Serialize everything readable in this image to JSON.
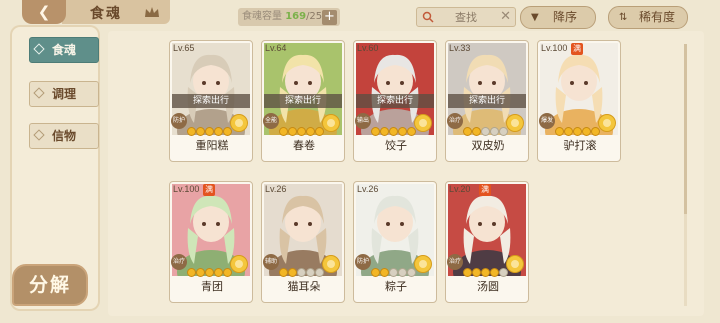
{
  "header": {
    "back_icon": "back-arrow-icon",
    "title": "食魂",
    "crown_icon": "crown-icon",
    "capacity_label": "食魂容量",
    "capacity_current": "169",
    "capacity_max": "/250",
    "capacity_add_label": "+",
    "search_placeholder": "查找",
    "search_value": "",
    "clear_glyph": "✕",
    "sort_order_label": "降序",
    "sort_rarity_label": "稀有度",
    "sort_order_icon": "▼",
    "sort_rarity_icon": "⇅"
  },
  "sidebar": {
    "tabs": [
      {
        "label": "食魂",
        "active": true
      },
      {
        "label": "调理",
        "active": false
      },
      {
        "label": "信物",
        "active": false
      }
    ],
    "decompose_label": "分解"
  },
  "cards": [
    {
      "level": "Lv.65",
      "name": "重阳糕",
      "status": "探索出行",
      "full_badge": "",
      "tag": "防护",
      "stars_filled": 5,
      "stars_total": 5,
      "palette": [
        "#d8ccb8",
        "#a89680",
        "#e7dfcf"
      ]
    },
    {
      "level": "Lv.64",
      "name": "春卷",
      "status": "探索出行",
      "full_badge": "",
      "tag": "全能",
      "stars_filled": 5,
      "stars_total": 5,
      "palette": [
        "#f2e3a8",
        "#d7a83f",
        "#a9c36c"
      ]
    },
    {
      "level": "Lv.60",
      "name": "饺子",
      "status": "探索出行",
      "full_badge": "",
      "tag": "输出",
      "stars_filled": 5,
      "stars_total": 5,
      "palette": [
        "#e8e6e4",
        "#b8b2ac",
        "#c3433c"
      ]
    },
    {
      "level": "Lv.33",
      "name": "双皮奶",
      "status": "探索出行",
      "full_badge": "",
      "tag": "治疗",
      "stars_filled": 2,
      "stars_total": 5,
      "palette": [
        "#f1dcb4",
        "#e0b96a",
        "#cfc9c2"
      ]
    },
    {
      "level": "Lv.100",
      "name": "驴打滚",
      "status": "",
      "full_badge": "满",
      "tag": "爆发",
      "stars_filled": 5,
      "stars_total": 5,
      "palette": [
        "#f5ddb3",
        "#e8a748",
        "#f2eee6"
      ]
    },
    {
      "level": "Lv.100",
      "name": "青团",
      "status": "",
      "full_badge": "满",
      "tag": "治疗",
      "stars_filled": 5,
      "stars_total": 5,
      "palette": [
        "#cfe6b8",
        "#7eb26a",
        "#e8a3a5"
      ]
    },
    {
      "level": "Lv.26",
      "name": "猫耳朵",
      "status": "",
      "full_badge": "",
      "tag": "辅助",
      "stars_filled": 2,
      "stars_total": 5,
      "palette": [
        "#d9c3a4",
        "#8b6a4e",
        "#e5dccf"
      ]
    },
    {
      "level": "Lv.26",
      "name": "粽子",
      "status": "",
      "full_badge": "",
      "tag": "防护",
      "stars_filled": 2,
      "stars_total": 5,
      "palette": [
        "#e2e5dc",
        "#7f9b76",
        "#f0f0ea"
      ]
    },
    {
      "level": "Lv.20",
      "name": "汤圆",
      "status": "",
      "full_badge": "满",
      "tag": "治疗",
      "stars_filled": 4,
      "stars_total": 5,
      "palette": [
        "#f2ece2",
        "#3a3a44",
        "#c64b44"
      ]
    }
  ],
  "colors": {
    "accent_teal": "#5f8f8a",
    "star_gold": "#f2b625",
    "full_red": "#e3541f",
    "capacity_green": "#7bb14a"
  }
}
